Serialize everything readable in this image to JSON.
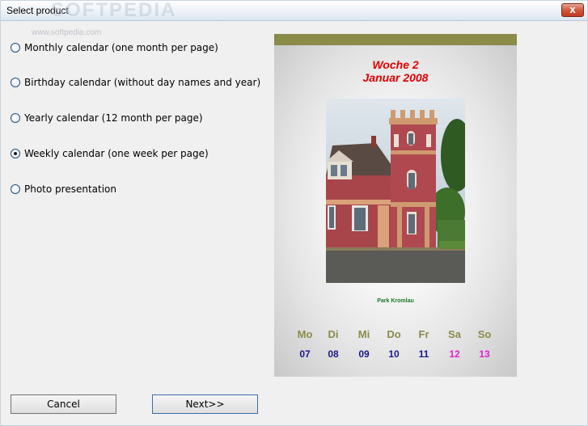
{
  "window": {
    "title": "Select product",
    "watermark": "SOFTPEDIA",
    "watermark_url": "www.softpedia.com",
    "close_label": "x"
  },
  "options": [
    {
      "label": "Monthly calendar (one month per page)",
      "checked": false
    },
    {
      "label": "Birthday calendar (without day names and year)",
      "checked": false
    },
    {
      "label": "Yearly calendar (12 month per page)",
      "checked": false
    },
    {
      "label": "Weekly calendar (one week per page)",
      "checked": true
    },
    {
      "label": "Photo presentation",
      "checked": false
    }
  ],
  "preview": {
    "week": "Woche 2",
    "month": "Januar 2008",
    "caption": "Park Kromlau",
    "days": [
      {
        "name": "Mo",
        "num": "07",
        "weekend": false
      },
      {
        "name": "Di",
        "num": "08",
        "weekend": false
      },
      {
        "name": "Mi",
        "num": "09",
        "weekend": false
      },
      {
        "name": "Do",
        "num": "10",
        "weekend": false
      },
      {
        "name": "Fr",
        "num": "11",
        "weekend": false
      },
      {
        "name": "Sa",
        "num": "12",
        "weekend": true
      },
      {
        "name": "So",
        "num": "13",
        "weekend": true
      }
    ],
    "colors": {
      "bar": "#8b8b4a",
      "title": "#e00000",
      "weekday": "#1a1a8a",
      "weekend": "#e020d0"
    }
  },
  "buttons": {
    "cancel": "Cancel",
    "next": "Next>>"
  }
}
